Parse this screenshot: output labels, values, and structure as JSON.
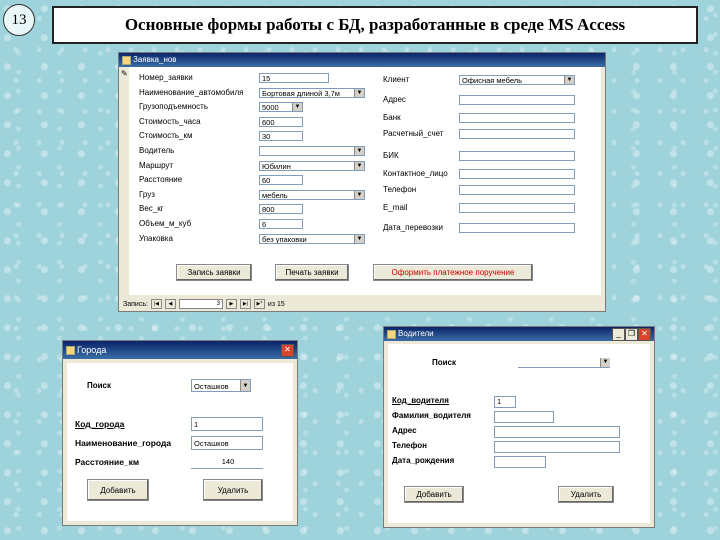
{
  "slide": {
    "number": "13",
    "title": "Основные формы работы с БД, разработанные в среде MS Access"
  },
  "order_form": {
    "title": "Заявка_нов",
    "left_labels": [
      "Номер_заявки",
      "Наименование_автомобиля",
      "Грузоподъемность",
      "Стоимость_часа",
      "Стоимость_км",
      "Водитель",
      "Маршрут",
      "Расстояние",
      "Груз",
      "Вес_кг",
      "Объем_м_куб",
      "Упаковка"
    ],
    "left_values": [
      "15",
      "Бортовая длиной 3,7м",
      "5000",
      "600",
      "30",
      "",
      "Юбилин",
      "60",
      "мебель",
      "800",
      "6",
      "без упаковки"
    ],
    "right_labels": [
      "Клиент",
      "Адрес",
      "Банк",
      "Расчетный_счет",
      "БИК",
      "Контактное_лицо",
      "Телефон",
      "E_mail",
      "Дата_перевозки"
    ],
    "right_values": [
      "Офисная мебель",
      "",
      "",
      "",
      "",
      "",
      "",
      "",
      ""
    ],
    "buttons": {
      "save": "Запись заявки",
      "print": "Печать заявки",
      "payment": "Оформить платежное поручение"
    },
    "nav": {
      "prefix": "Запись:",
      "current": "3",
      "total": "из 15"
    }
  },
  "cities_form": {
    "title": "Города",
    "search_label": "Поиск",
    "search_value": "Осташков",
    "labels": [
      "Код_города",
      "Наименование_города",
      "Расстояние_км"
    ],
    "values": [
      "1",
      "Осташков",
      "140"
    ],
    "buttons": {
      "add": "Добавить",
      "delete": "Удалить"
    }
  },
  "drivers_form": {
    "title": "Водители",
    "search_label": "Поиск",
    "search_value": "",
    "labels": [
      "Код_водителя",
      "Фамилия_водителя",
      "Адрес",
      "Телефон",
      "Дата_рождения"
    ],
    "values": [
      "1",
      "",
      "",
      "",
      ""
    ],
    "buttons": {
      "add": "Добавить",
      "delete": "Удалить"
    }
  },
  "icons": [
    "restore-icon",
    "close-icon",
    "dropdown-arrow-icon",
    "record-selector-icon",
    "first-record-icon",
    "prev-record-icon",
    "next-record-icon",
    "last-record-icon",
    "new-record-icon"
  ]
}
